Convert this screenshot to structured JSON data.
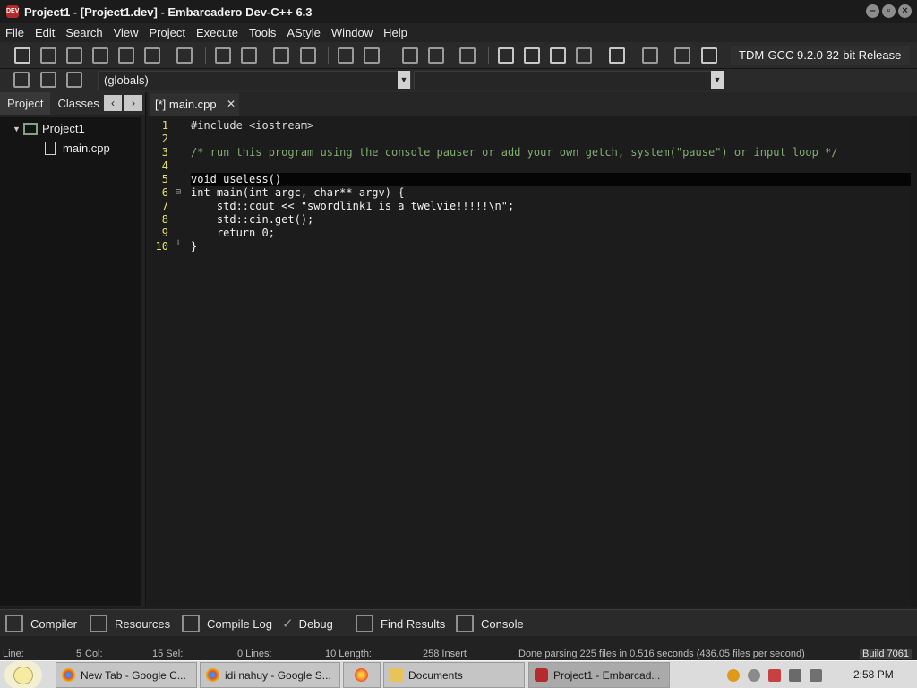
{
  "window": {
    "title": "Project1 - [Project1.dev] - Embarcadero Dev-C++ 6.3",
    "app_icon_text": "DEV"
  },
  "menu": [
    "File",
    "Edit",
    "Search",
    "View",
    "Project",
    "Execute",
    "Tools",
    "AStyle",
    "Window",
    "Help"
  ],
  "toolbar": {
    "compiler_selected": "TDM-GCC 9.2.0 32-bit Release",
    "scope_selected": "(globals)",
    "function_selected": ""
  },
  "left_panel": {
    "tabs": [
      "Project",
      "Classes"
    ],
    "active_tab": "Project",
    "tree": {
      "project": "Project1",
      "files": [
        "main.cpp"
      ]
    }
  },
  "editor": {
    "tab_label": "[*] main.cpp",
    "current_line": 5,
    "lines": [
      {
        "num": "1",
        "text": "#include <iostream>"
      },
      {
        "num": "2",
        "text": ""
      },
      {
        "num": "3",
        "text": "/* run this program using the console pauser or add your own getch, system(\"pause\") or input loop */"
      },
      {
        "num": "4",
        "text": ""
      },
      {
        "num": "5",
        "text": "void useless()"
      },
      {
        "num": "6",
        "text": "int main(int argc, char** argv) {"
      },
      {
        "num": "7",
        "text": "    std::cout << \"swordlink1 is a twelvie!!!!!\\n\";"
      },
      {
        "num": "8",
        "text": "    std::cin.get();"
      },
      {
        "num": "9",
        "text": "    return 0;"
      },
      {
        "num": "10",
        "text": "}"
      }
    ]
  },
  "bottom_tabs": [
    "Compiler",
    "Resources",
    "Compile Log",
    "Debug",
    "Find Results",
    "Console"
  ],
  "status": {
    "line": "Line:",
    "line_val": "5",
    "col": "Col:",
    "sel": "15 Sel:",
    "lines": "0 Lines:",
    "length": "10 Length:",
    "mode": "258 Insert",
    "message": "Done parsing 225 files in 0.516 seconds (436.05 files per second)",
    "build": "Build 7061"
  },
  "taskbar": {
    "items": [
      {
        "label": "New Tab - Google C...",
        "icon": "chrome-icon"
      },
      {
        "label": "idi nahuy - Google S...",
        "icon": "chrome-icon"
      },
      {
        "label": "",
        "icon": "firefox-icon"
      },
      {
        "label": "Documents",
        "icon": "folder-icon"
      },
      {
        "label": "Project1 - Embarcad...",
        "icon": "devcpp-icon"
      }
    ],
    "clock": "2:58 PM"
  },
  "colors": {
    "accent_line_numbers": "#e8e060",
    "comment": "#7fae6f",
    "type_keyword": "#9fa0e0"
  }
}
